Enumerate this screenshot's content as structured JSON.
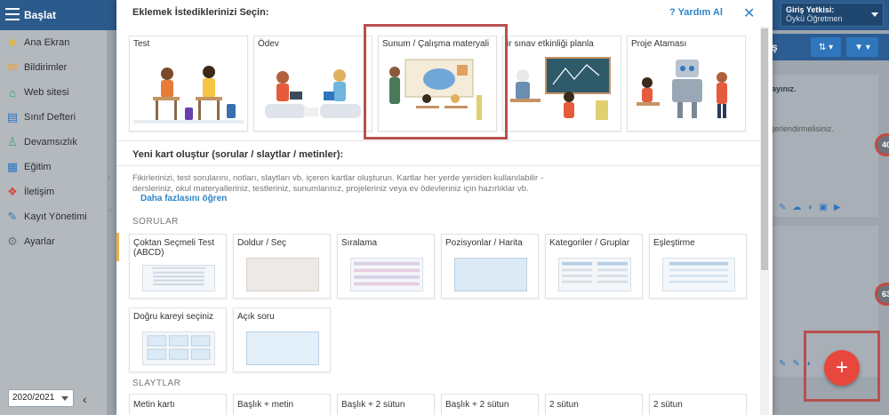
{
  "topbar": {
    "brand": "Başlat",
    "role_label": "Giriş Yetkisi:",
    "role_value": "Öykü Öğretmen"
  },
  "sidebar": {
    "items": [
      {
        "label": "Ana Ekran",
        "icon": "star-icon",
        "color": "#f0b429"
      },
      {
        "label": "Bildirimler",
        "icon": "mail-icon",
        "color": "#f0a030"
      },
      {
        "label": "Web sitesi",
        "icon": "house-icon",
        "color": "#2e9a6b"
      },
      {
        "label": "Sınıf Defteri",
        "icon": "notebook-icon",
        "color": "#2f76bd"
      },
      {
        "label": "Devamsızlık",
        "icon": "person-icon",
        "color": "#3aa876"
      },
      {
        "label": "Eğitim",
        "icon": "education-icon",
        "color": "#2f76bd"
      },
      {
        "label": "İletişim",
        "icon": "chat-icon",
        "color": "#d9463e"
      },
      {
        "label": "Kayıt Yönetimi",
        "icon": "pen-icon",
        "color": "#2f76bd"
      },
      {
        "label": "Ayarlar",
        "icon": "gear-icon",
        "color": "#6c757d"
      }
    ],
    "year": "2020/2021"
  },
  "background": {
    "card1_text": "ayınız.",
    "card1_sub": "ğerlendirmelisiniz.",
    "badge1": "40",
    "badge2": "63",
    "toolbar_title": "ş"
  },
  "modal": {
    "title": "Eklemek İstediklerinizi Seçin:",
    "help": "Yardım Al",
    "categories": [
      {
        "label": "Test"
      },
      {
        "label": "Ödev"
      },
      {
        "label": "Sunum / Çalışma materyali"
      },
      {
        "label": "ir sınav etkinliği planla"
      },
      {
        "label": "Proje Ataması"
      }
    ],
    "new_card_title": "Yeni kart oluştur (sorular / slaytlar / metinler):",
    "description": "Fikirlerinizi, test sorularını, notları, slaytları vb. içeren kartlar oluşturun. Kartlar her yerde yeniden kullanılabilir - dersleriniz, okul materyalleriniz, testleriniz, sunumlarınız, projeleriniz veya ev ödevleriniz için hazırlıklar vb.",
    "more_link": "Daha fazlasını öğren",
    "questions_label": "SORULAR",
    "questions": [
      {
        "label": "Çoktan Seçmeli Test (ABCD)"
      },
      {
        "label": "Doldur / Seç"
      },
      {
        "label": "Sıralama"
      },
      {
        "label": "Pozisyonlar / Harita"
      },
      {
        "label": "Kategoriler / Gruplar"
      },
      {
        "label": "Eşleştirme"
      },
      {
        "label": "Doğru kareyi seçiniz"
      },
      {
        "label": "Açık soru"
      }
    ],
    "slides_label": "SLAYTLAR",
    "slides": [
      {
        "label": "Metin kartı"
      },
      {
        "label": "Başlık + metin"
      },
      {
        "label": "Başlık + 2 sütun"
      },
      {
        "label": "Başlık + 2 sütun"
      },
      {
        "label": "2 sütun"
      },
      {
        "label": "2 sütun"
      }
    ]
  },
  "colors": {
    "accent": "#2c86c8",
    "highlight": "#b8504f",
    "fab": "#e8473d",
    "topbar": "#2b5a8c"
  }
}
